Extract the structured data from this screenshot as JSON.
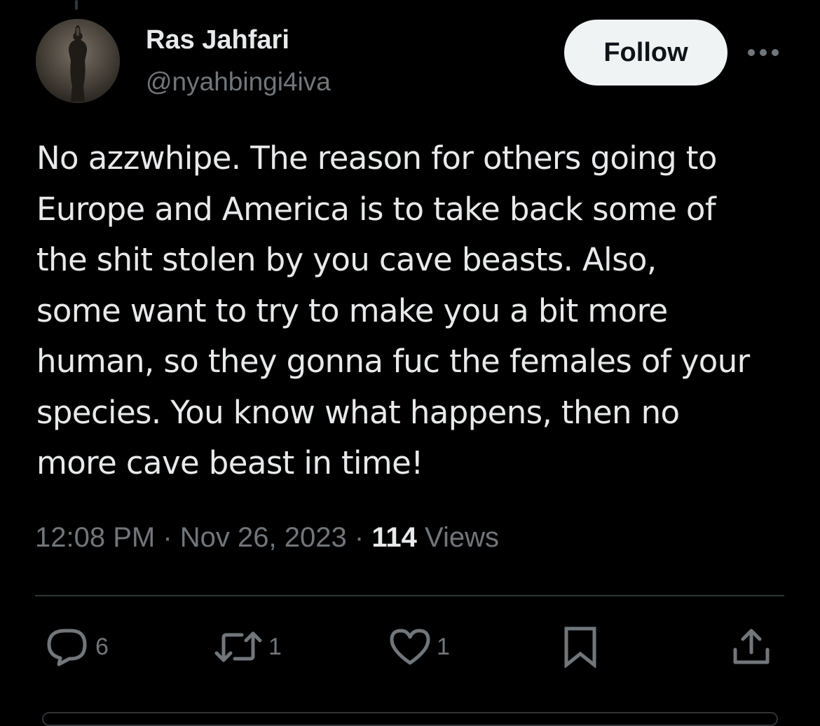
{
  "author": {
    "name": "Ras Jahfari",
    "handle": "@nyahbingi4iva"
  },
  "follow_button": {
    "label": "Follow"
  },
  "tweet": {
    "text": "No azzwhipe. The reason for others going to\nEurope and America is to take back some of\nthe shit stolen by you cave beasts. Also,\nsome want to try to make you a bit more\nhuman, so they gonna fuc the females of your\nspecies. You know what happens, then no\nmore cave beast in time!"
  },
  "meta": {
    "time": "12:08 PM",
    "separator": "·",
    "date": "Nov 26, 2023",
    "views_count": "114",
    "views_label": "Views"
  },
  "actions": {
    "reply": {
      "icon": "reply-icon",
      "count": "6"
    },
    "repost": {
      "icon": "repost-icon",
      "count": "1"
    },
    "like": {
      "icon": "heart-icon",
      "count": "1"
    },
    "bookmark": {
      "icon": "bookmark-icon"
    },
    "share": {
      "icon": "share-icon"
    }
  },
  "colors": {
    "background": "#000000",
    "primary_text": "#e7e9ea",
    "secondary_text": "#71767b",
    "follow_button_bg": "#eff3f4",
    "divider": "#2f3336"
  }
}
